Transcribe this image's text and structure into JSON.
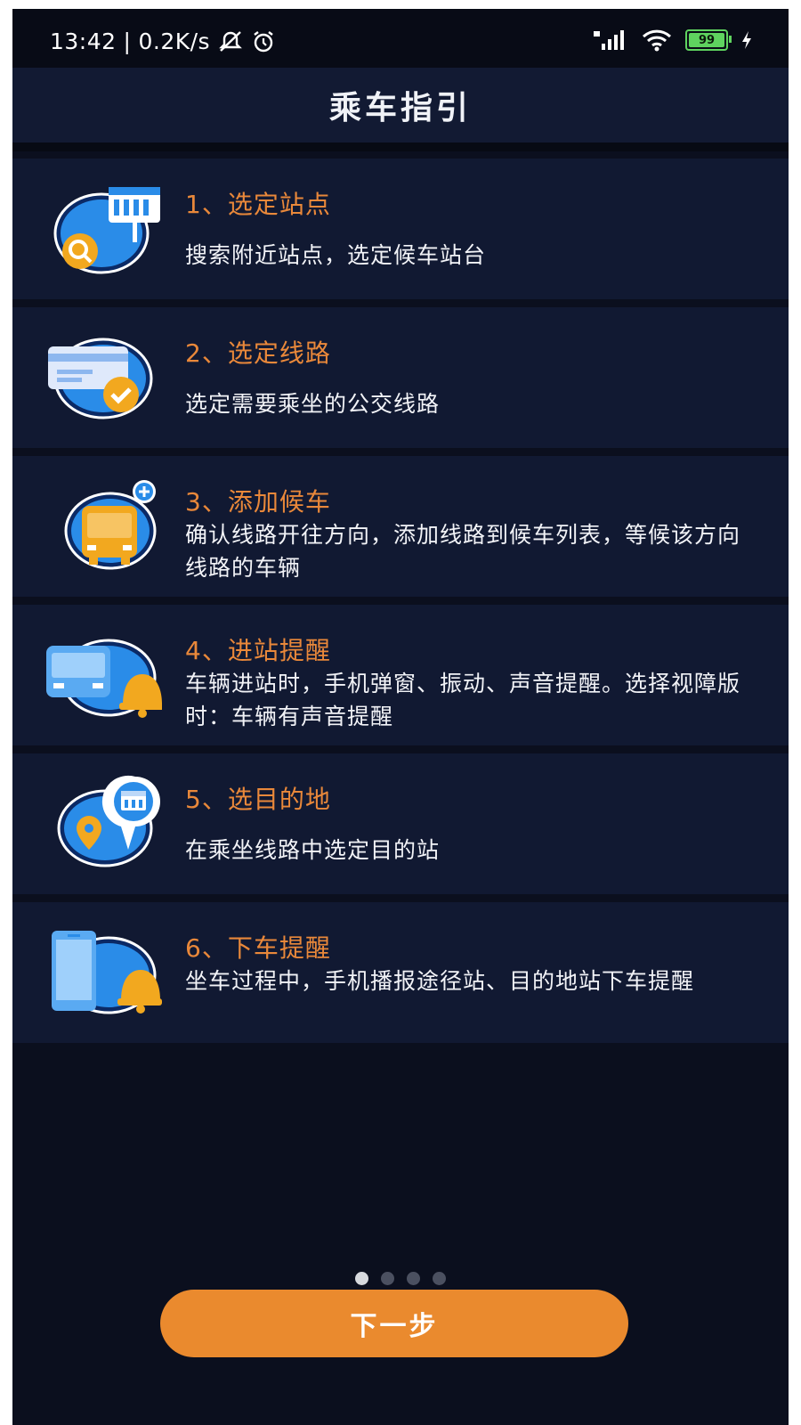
{
  "status_bar": {
    "time": "13:42",
    "net_speed": "0.2K/s",
    "battery": "99",
    "icons": [
      "mute-icon",
      "alarm-icon",
      "signal-icon",
      "wifi-icon",
      "battery-icon",
      "charging-icon"
    ]
  },
  "header": {
    "title": "乘车指引"
  },
  "steps": [
    {
      "title": "1、选定站点",
      "desc": "搜索附近站点，选定候车站台",
      "icon": "search-station-icon"
    },
    {
      "title": "2、选定线路",
      "desc": "选定需要乘坐的公交线路",
      "icon": "route-check-icon"
    },
    {
      "title": "3、添加候车",
      "desc": "确认线路开往方向，添加线路到候车列表，等候该方向线路的车辆",
      "icon": "add-bus-icon"
    },
    {
      "title": "4、进站提醒",
      "desc": "车辆进站时，手机弹窗、振动、声音提醒。选择视障版时：车辆有声音提醒",
      "icon": "bus-bell-icon"
    },
    {
      "title": "5、选目的地",
      "desc": "在乘坐线路中选定目的站",
      "icon": "destination-icon"
    },
    {
      "title": "6、下车提醒",
      "desc": "坐车过程中，手机播报途径站、目的地站下车提醒",
      "icon": "phone-bell-icon"
    }
  ],
  "pager": {
    "total": 4,
    "active_index": 0
  },
  "footer": {
    "next_label": "下一步"
  },
  "colors": {
    "accent": "#ea8a2e",
    "background": "#0b0f1e",
    "card": "#111932",
    "icon_blue": "#2a8ce8"
  }
}
